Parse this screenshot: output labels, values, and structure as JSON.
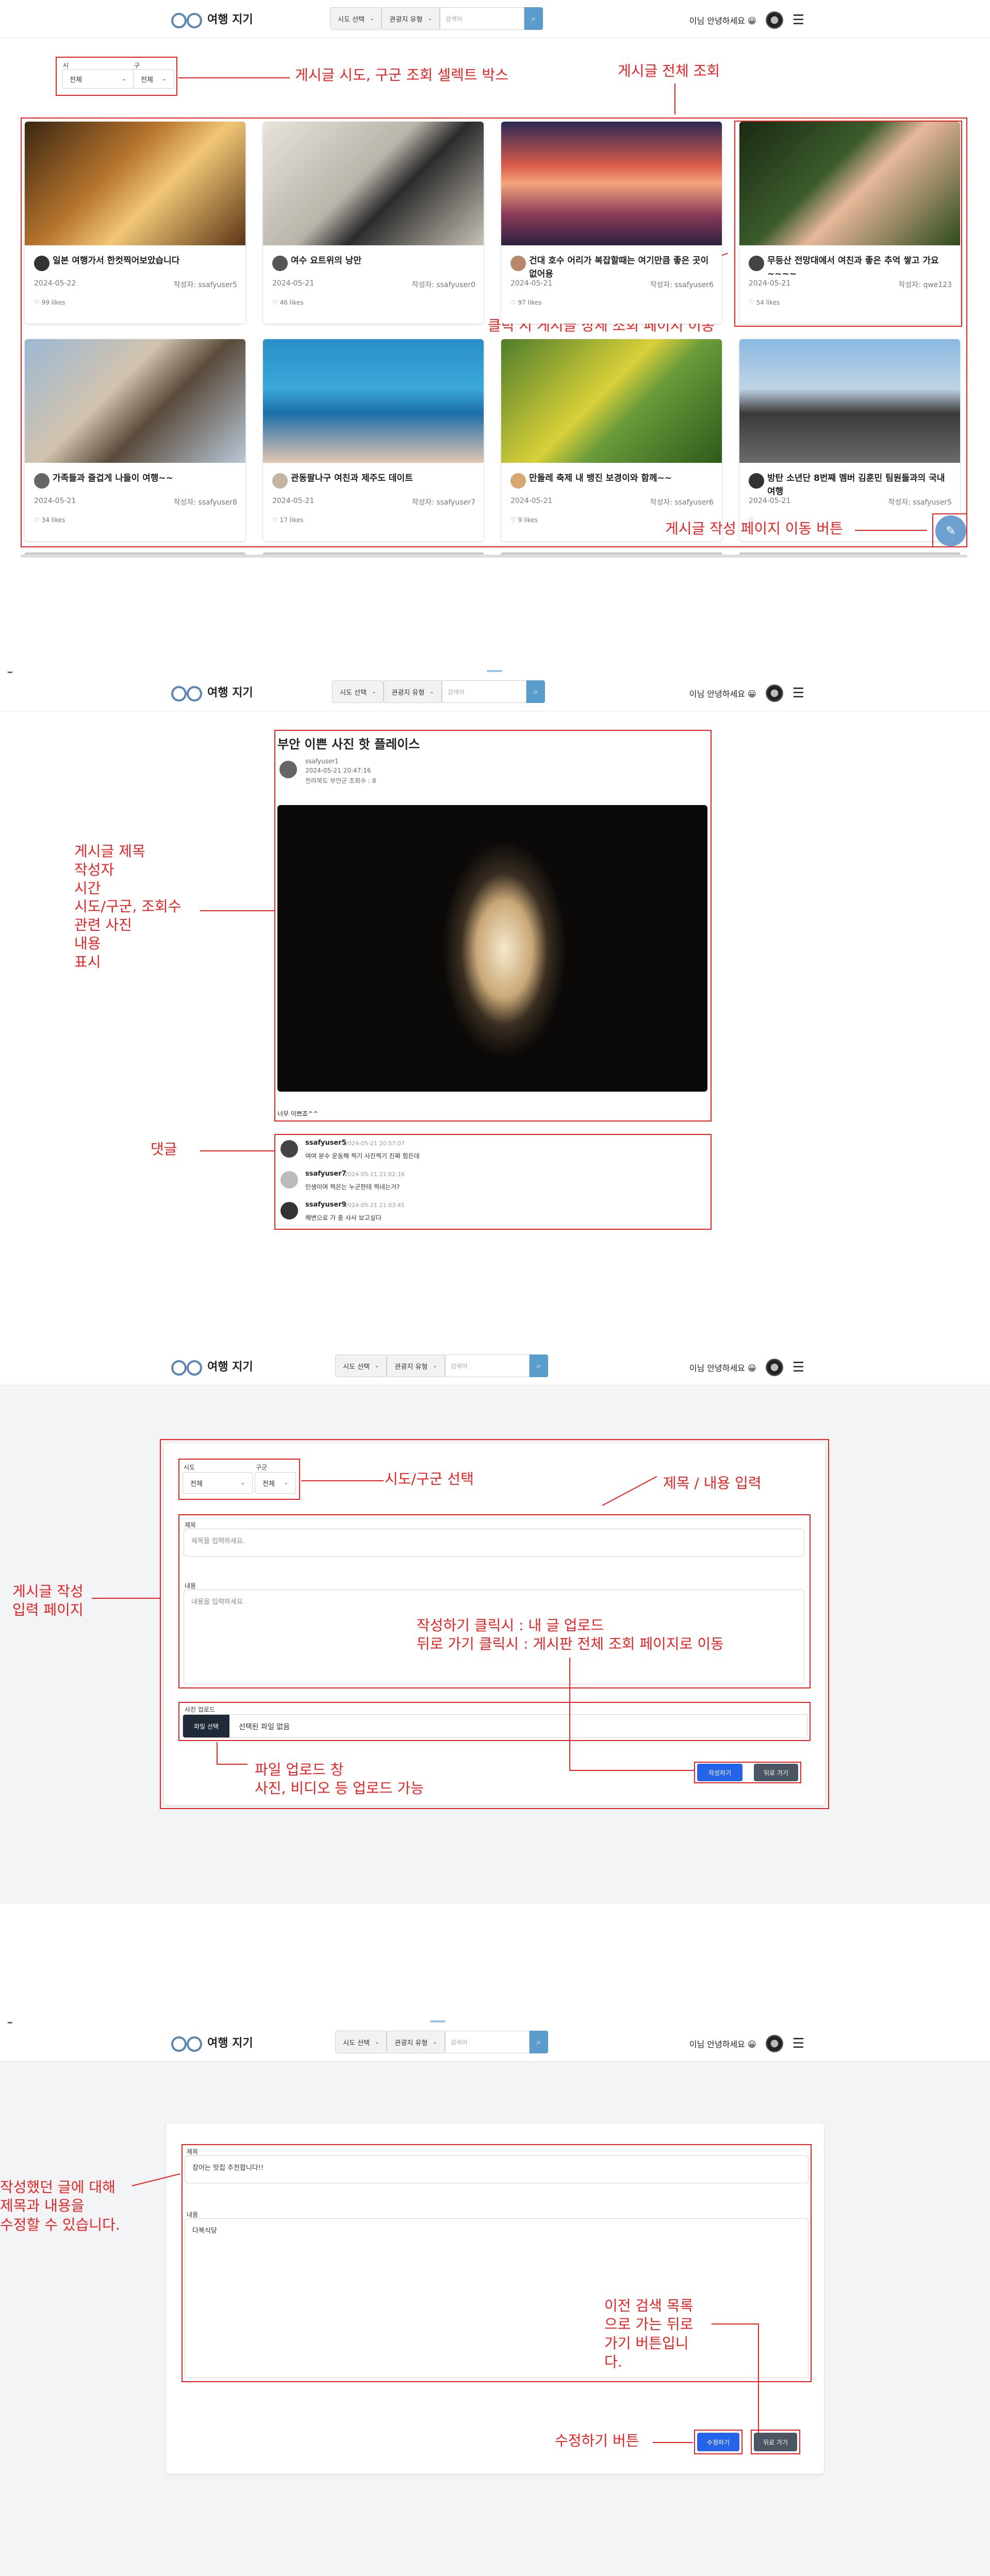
{
  "nav": {
    "title": "여행 지기",
    "sido_select": "시도 선택",
    "type_select": "관광지 유형",
    "keyword_placeholder": "검색어",
    "greeting": "이님 안녕하세요 😀",
    "search_icon": "search-icon",
    "menu_icon": "hamburger-icon"
  },
  "section1": {
    "filter": {
      "sido_label": "시도",
      "sido_value": "전체",
      "gugun_label": "구군",
      "gugun_value": "전체"
    },
    "annotations": {
      "select_box": "게시글 시도, 구군 조회 셀렉트 박스",
      "all_posts": "게시글 전체 조회",
      "click_detail": "클릭 시 게시글 상세 조회 페이지 이동",
      "write_button": "게시글 작성 페이지 이동 버튼"
    },
    "cards": [
      {
        "title": "일본 여행가서 한컷찍어보았습니다",
        "date": "2024-05-22",
        "author": "작성자: ssafyuser5",
        "likes": "99 likes"
      },
      {
        "title": "여수 요트위의 낭만",
        "date": "2024-05-21",
        "author": "작성자: ssafyuser0",
        "likes": "46 likes"
      },
      {
        "title": "건대 호수 어리가 복잡할때는 여기만큼 좋은 곳이 없어용",
        "date": "2024-05-21",
        "author": "작성자: ssafyuser6",
        "likes": "97 likes"
      },
      {
        "title": "무등산 전망대에서 여친과 좋은 추억 쌓고 가요~~~~",
        "date": "2024-05-21",
        "author": "작성자: qwe123",
        "likes": "54 likes"
      },
      {
        "title": "가족들과 즐겁게 나들이 여행~~",
        "date": "2024-05-21",
        "author": "작성자: ssafyuser8",
        "likes": "34 likes"
      },
      {
        "title": "관동팔나구 여친과 제주도 데이트",
        "date": "2024-05-21",
        "author": "작성자: ssafyuser7",
        "likes": "17 likes"
      },
      {
        "title": "만돌레 축제 내 뱅진 보경이와 함께~~",
        "date": "2024-05-21",
        "author": "작성자: ssafyuser6",
        "likes": "9 likes"
      },
      {
        "title": "방탄 소년단 8번째 멤버 김훈민 팀원들과의 국내 여행",
        "date": "2024-05-21",
        "author": "작성자: ssafyuser5",
        "likes": ""
      }
    ]
  },
  "section2": {
    "post_title": "부안 이쁜 사진 핫 플레이스",
    "author": "ssafyuser1",
    "datetime": "2024-05-21 20:47:16",
    "meta": "전라북도 부안군 조회수 : 8",
    "content": "너무 이쁘죠^^",
    "annotations": {
      "detail": "게시글 제목\n작성자\n시간\n시도/구군, 조회수\n관련 사진\n내용\n표시",
      "comments": "댓글"
    },
    "comments": [
      {
        "user": "ssafyuser5",
        "date": "2024-05-21 20:57:07",
        "text": "여여 분수 운동해 찍기 사진찍기 진짜 힘든데"
      },
      {
        "user": "ssafyuser7",
        "date": "2024-05-21 21:02:16",
        "text": "인생이여 찍은는 누군한테 찍네는거?"
      },
      {
        "user": "ssafyuser9",
        "date": "2024-05-21 21:03:45",
        "text": "해변으로 가 중 사사 보고싶다"
      }
    ]
  },
  "section3": {
    "sido_label": "시도",
    "sido_value": "전체",
    "gugun_label": "구군",
    "gugun_value": "전체",
    "title_label": "제목",
    "title_placeholder": "제목을 입력하세요.",
    "content_label": "내용",
    "content_placeholder": "내용을 입력하세요.",
    "file_label": "사진 업로드",
    "file_button": "파일 선택",
    "file_status": "선택된 파일 없음",
    "submit": "작성하기",
    "back": "뒤로 가기",
    "annotations": {
      "sido_gugun": "시도/구군 선택",
      "title_content": "제목 / 내용 입력",
      "page": "게시글 작성\n입력 페이지",
      "actions": "작성하기 클릭시 : 내 글 업로드\n뒤로 가기 클릭시 : 게시판 전체 조회 페이지로 이동",
      "upload": "파일 업로드 창\n사진, 비디오 등 업로드 가능"
    }
  },
  "section4": {
    "title_label": "제목",
    "title_value": "장어는 맛집 추천합니다!!",
    "content_label": "내용",
    "content_value": "다복식당",
    "submit": "수정하기",
    "back": "뒤로 가기",
    "annotations": {
      "edit": "작성했던 글에 대해\n제목과 내용을\n수정할 수 있습니다.",
      "back": "이전 검색 목록\n으로 가는 뒤로\n가기 버튼입니\n다.",
      "edit_button": "수정하기 버튼"
    }
  },
  "colors": {
    "accent": "#ee2222",
    "primary": "#2563eb",
    "search": "#5a9ccc"
  }
}
